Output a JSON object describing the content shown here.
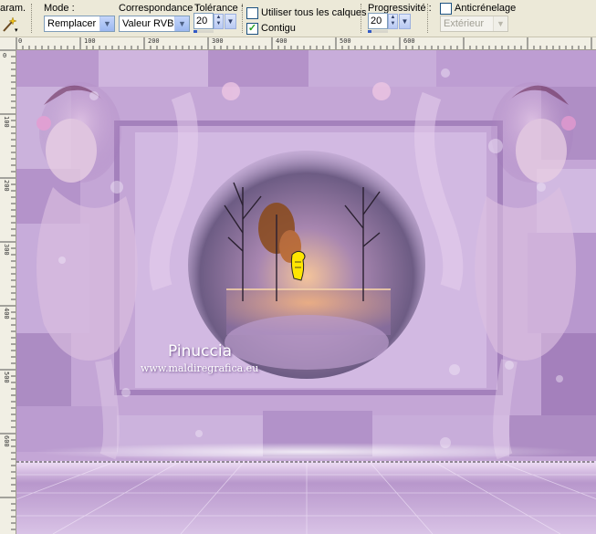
{
  "toolbar": {
    "param_label": "aram.",
    "mode": {
      "label": "Mode :",
      "value": "Remplacer"
    },
    "correspondance": {
      "label": "Correspondance :",
      "value": "Valeur RVB"
    },
    "tolerance": {
      "label": "Tolérance :",
      "value": "20"
    },
    "use_all_layers": {
      "label": "Utiliser tous les calques",
      "checked": false
    },
    "contigu": {
      "label": "Contigu",
      "checked": true
    },
    "progressivite": {
      "label": "Progressivité :",
      "value": "20"
    },
    "antialias": {
      "label": "Anticrénelage",
      "checked": false
    },
    "antialias_mode": {
      "value": "Extérieur",
      "enabled": false
    }
  },
  "ruler": {
    "h_labels": [
      "0",
      "100",
      "200",
      "300",
      "400",
      "500",
      "600"
    ],
    "v_labels": [
      "0",
      "100",
      "200",
      "300",
      "400",
      "500",
      "600"
    ]
  },
  "canvas": {
    "watermark_name": "Pinuccia",
    "watermark_url": "www.maldiregrafica.eu",
    "palette": {
      "lavender": "#c4a6d6",
      "deep_violet": "#8a5aa8",
      "light_lilac": "#e6d6f0",
      "sunset": "#e8a070",
      "tree": "#2a2030"
    }
  }
}
